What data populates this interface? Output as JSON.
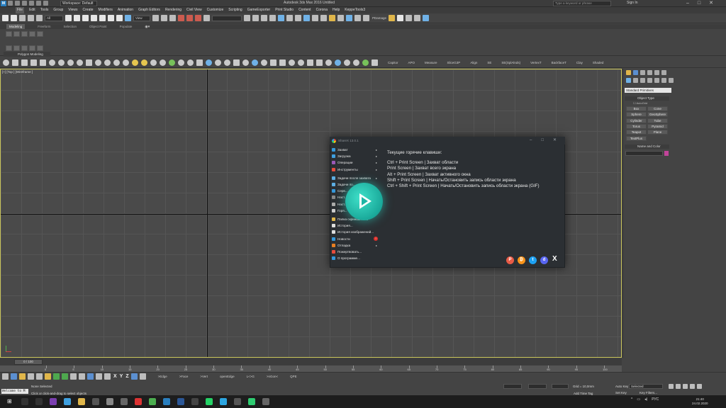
{
  "titlebar": {
    "logo": "M",
    "workspace": "Workspace: Default",
    "title": "Autodesk 3ds Max 2016     Untitled",
    "search_placeholder": "Type a keyword or phrase",
    "signin": "Sign In"
  },
  "menus": [
    "Edit",
    "Tools",
    "Group",
    "Views",
    "Create",
    "Modifiers",
    "Animation",
    "Graph Editors",
    "Rendering",
    "Civil View",
    "Customize",
    "Scripting",
    "GameExporter",
    "Print Studio",
    "Content",
    "Corona",
    "Help",
    "KeppeTools3"
  ],
  "menu_active": "File",
  "toolbar": {
    "selection_filter": "All",
    "coord_system": "View",
    "pdamage_label": "PDamage"
  },
  "ribbon": {
    "tabs": [
      "Modeling",
      "Freeform",
      "Selection",
      "Object Paint",
      "Populate"
    ],
    "panel_label": "Polygon Modeling"
  },
  "sectoolbar": {
    "labels": [
      "Capitor",
      "APO",
      "Measure",
      "SliceG3P",
      "Align",
      "SE",
      "SE(SplAlnds)",
      "VertexT",
      "BackfaceT",
      "Clay",
      "Shaded"
    ]
  },
  "viewport": {
    "label": "[+] [Top ] [Wireframe ]"
  },
  "command_panel": {
    "dropdown": "Standard Primitives",
    "object_type_title": "Object Type",
    "autogrid": "AutoGrid",
    "buttons": [
      "Box",
      "Cone",
      "Sphere",
      "GeoSphere",
      "Cylinder",
      "Tube",
      "Torus",
      "Pyramid",
      "Teapot",
      "Plane",
      "TextPlus"
    ],
    "name_color_title": "Name and Color"
  },
  "timeline": {
    "frame": "0 / 100",
    "ticks": [
      "0",
      "5",
      "10",
      "15",
      "20",
      "25",
      "30",
      "35",
      "40",
      "45",
      "50",
      "55",
      "60",
      "65",
      "70",
      "75",
      "80",
      "85",
      "90",
      "95",
      "100"
    ]
  },
  "bottom": {
    "tool_labels": [
      ">Edge",
      ">Face",
      ">Vert",
      "openEdge",
      "L<>G",
      ">nGon<",
      "QPE"
    ],
    "maxscript": "Welcome to M",
    "status_selected": "None Selected",
    "status_prompt": "Click or click-and-drag to select objects",
    "grid": "Grid = 10,0mm",
    "add_time_tag": "Add Time Tag",
    "auto_key": "Auto Key",
    "set_key": "Set Key",
    "selected": "Selected",
    "key_filters": "Key Filters..."
  },
  "taskbar": {
    "lang": "РУС",
    "time": "21:40",
    "date": "24.02.2020"
  },
  "sharex": {
    "title": "ShareX 13.0.1",
    "menu": [
      {
        "label": "Захват",
        "arrow": "▸",
        "color": "#3498db"
      },
      {
        "label": "Загрузка",
        "arrow": "▸",
        "color": "#3fa0e0"
      },
      {
        "label": "Операции",
        "arrow": "▸",
        "color": "#9b59b6"
      },
      {
        "label": "Инструменты",
        "arrow": "▸",
        "color": "#e74c3c"
      },
      {
        "label": "",
        "sep": true
      },
      {
        "label": "Задачи после захвата",
        "arrow": "▸",
        "color": "#5dade2"
      },
      {
        "label": "Задачи по...",
        "arrow": "",
        "color": "#5dade2"
      },
      {
        "label": "Серв...",
        "arrow": "",
        "color": "#3498db"
      },
      {
        "label": "Наст...",
        "arrow": "",
        "color": "#888888"
      },
      {
        "label": "Наст...",
        "arrow": "",
        "color": "#aaaaaa"
      },
      {
        "label": "Горя...",
        "arrow": "",
        "color": "#cccccc"
      },
      {
        "label": "",
        "sep": true
      },
      {
        "label": "Папка скриншотов...",
        "arrow": "",
        "color": "#e0b64a"
      },
      {
        "label": "История...",
        "arrow": "",
        "color": "#dddddd"
      },
      {
        "label": "История изображений...",
        "arrow": "",
        "color": "#dddddd"
      },
      {
        "label": "Новости",
        "arrow": "",
        "color": "#3498db"
      },
      {
        "label": "Отладка",
        "arrow": "▸",
        "color": "#e67e22"
      },
      {
        "label": "Пожертвовать...",
        "arrow": "",
        "color": "#e74c3c"
      },
      {
        "label": "О программе...",
        "arrow": "",
        "color": "#3498db"
      }
    ],
    "news_badge": "!",
    "hotkeys_title": "Текущие горячие клавиши:",
    "hotkeys": [
      "Ctrl + Print Screen  |  Захват области",
      "Print Screen  |  Захват всего экрана",
      "Alt + Print Screen  |  Захват активного окна",
      "Shift + Print Screen  |  Начать/Остановить запись области экрана",
      "Ctrl + Shift + Print Screen  |  Начать/Остановить запись области экрана (GIF)"
    ],
    "social": [
      {
        "name": "patreon",
        "glyph": "P",
        "color": "#e85b46"
      },
      {
        "name": "bitcoin",
        "glyph": "₿",
        "color": "#f7931a"
      },
      {
        "name": "twitter",
        "glyph": "t",
        "color": "#1da1f2"
      },
      {
        "name": "discord",
        "glyph": "d",
        "color": "#5865f2"
      }
    ],
    "social_x": "X"
  }
}
